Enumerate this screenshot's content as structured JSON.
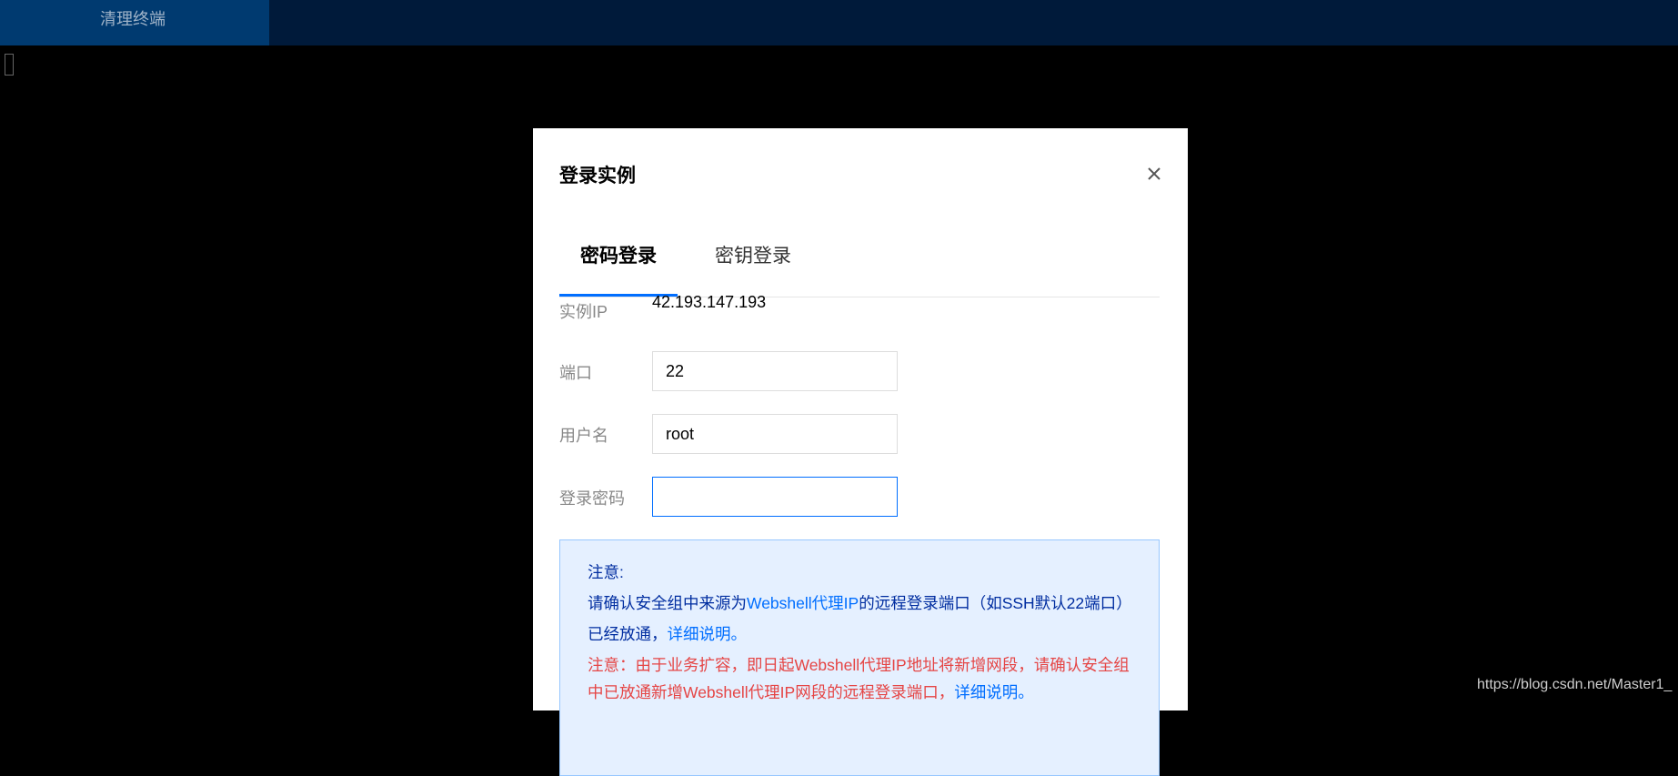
{
  "topbar": {
    "clear_terminal_label": "清理终端"
  },
  "modal": {
    "title": "登录实例",
    "close_icon": "close-icon",
    "tabs": [
      {
        "label": "密码登录",
        "active": true
      },
      {
        "label": "密钥登录",
        "active": false
      }
    ],
    "fields": {
      "instance_ip": {
        "label": "实例IP",
        "value": "42.193.147.193"
      },
      "port": {
        "label": "端口",
        "value": "22"
      },
      "username": {
        "label": "用户名",
        "value": "root"
      },
      "password": {
        "label": "登录密码",
        "value": ""
      }
    },
    "notice": {
      "heading": "注意:",
      "line1_prefix": "请确认安全组中来源为",
      "line1_link": "Webshell代理IP",
      "line1_suffix": "的远程登录端口（如SSH默认22端口）已经放通，",
      "line1_detail": "详细说明。",
      "warn_text": "注意：由于业务扩容，即日起Webshell代理IP地址将新增网段，请确认安全组中已放通新增Webshell代理IP网段的远程登录端口，",
      "warn_detail": "详细说明。"
    }
  },
  "watermark": "https://blog.csdn.net/Master1_",
  "colors": {
    "accent": "#006eff",
    "topbar_bg": "#001a3a",
    "tab_bg": "#003a70",
    "warning": "#e54545",
    "notice_bg": "#e5f0ff"
  }
}
